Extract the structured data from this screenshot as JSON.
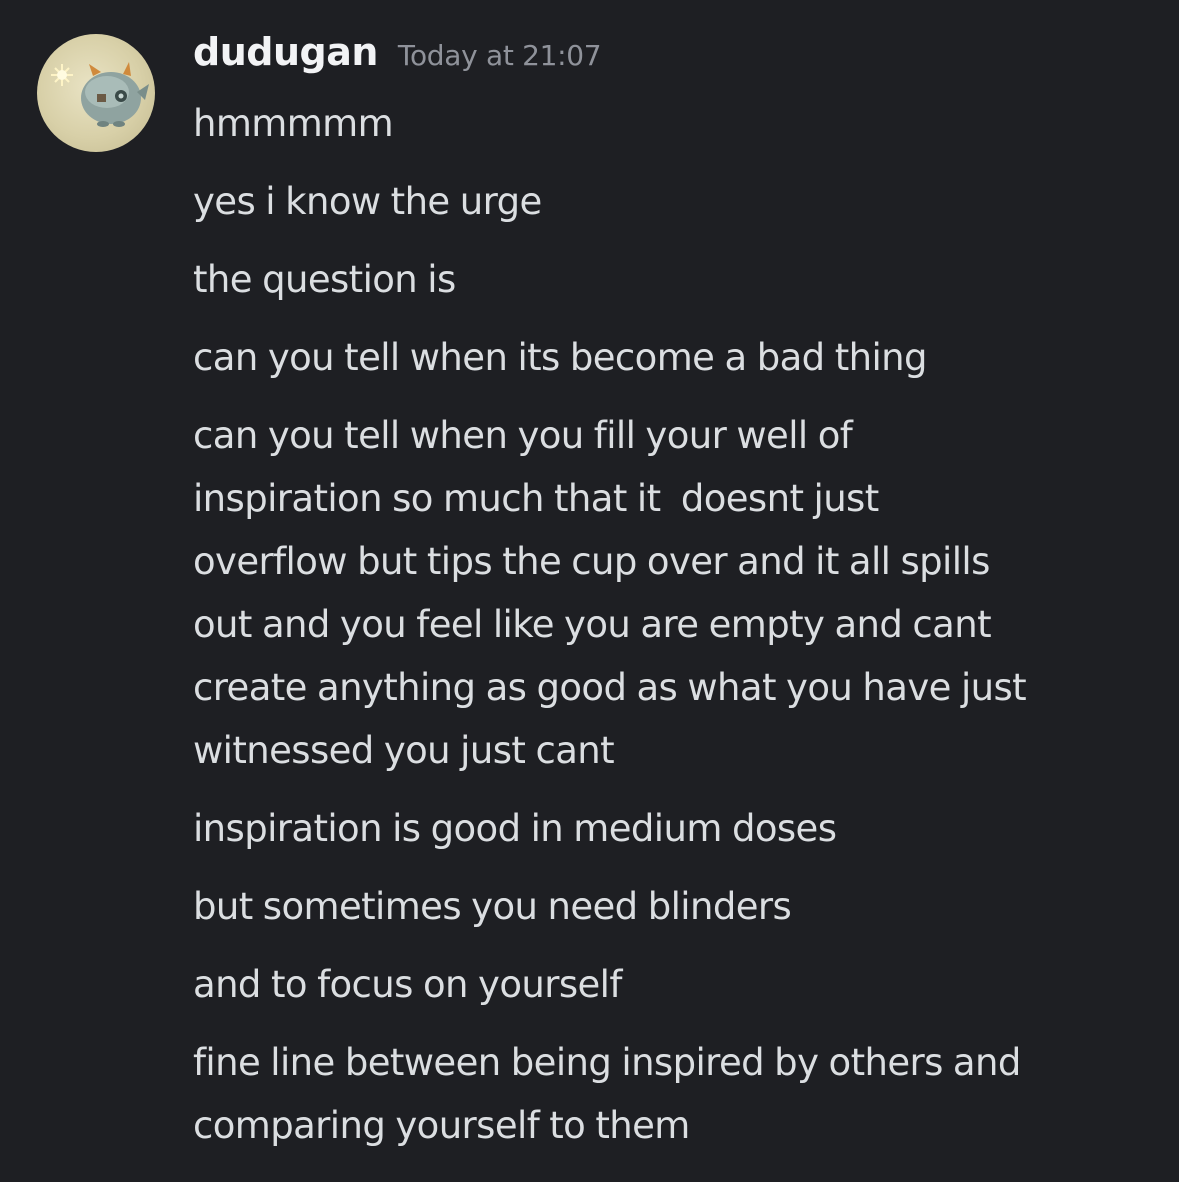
{
  "message_group": {
    "author": "dudugan",
    "timestamp": "Today at 21:07",
    "avatar_icon": "fluffy-creature-avatar"
  },
  "messages": [
    [
      "hmmmmm"
    ],
    [
      "yes i know the urge"
    ],
    [
      "the question is"
    ],
    [
      "can you tell when its become a bad thing"
    ],
    [
      "can you tell when you fill your well of",
      "inspiration so much that it  doesnt just",
      "overflow but tips the cup over and it all spills",
      "out and you feel like you are empty and cant",
      "create anything as good as what you have just",
      "witnessed you just cant"
    ],
    [
      "inspiration is good in medium doses"
    ],
    [
      "but sometimes you need blinders"
    ],
    [
      "and to focus on yourself"
    ],
    [
      "fine line between being inspired by others and",
      "comparing yourself to them"
    ]
  ],
  "colors": {
    "background": "#1e1f23",
    "author": "#f2f3f5",
    "timestamp": "#8f929a",
    "message_text": "#dbdee1"
  }
}
